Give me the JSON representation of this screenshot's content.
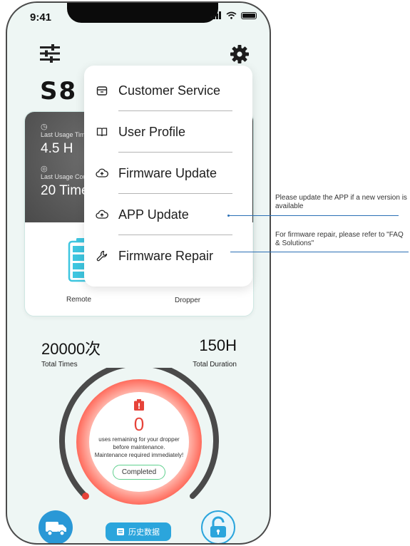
{
  "status_bar": {
    "time": "9:41"
  },
  "header": {
    "model": "S8"
  },
  "usage": [
    {
      "label": "Last Usage Time",
      "value": "4.5 H",
      "icon": "clock-icon"
    },
    {
      "label": "Last Usage Count",
      "value": "20 Times",
      "icon": "counter-icon"
    }
  ],
  "devices": {
    "remote_label": "Remote",
    "dropper_label": "Dropper"
  },
  "stats": {
    "total_times_value": "20000次",
    "total_times_label": "Total Times",
    "total_duration_value": "150H",
    "total_duration_label": "Total Duration"
  },
  "gauge": {
    "count": "0",
    "line1": "uses remaining for your dropper",
    "line2": "before maintenance.",
    "line3": "Maintenance required immediately!",
    "button": "Completed",
    "level": 0,
    "accent": "#e6433a"
  },
  "bottom_bar": {
    "history_label": "历史数据"
  },
  "menu": {
    "items": [
      {
        "label": "Customer Service",
        "icon": "service-icon"
      },
      {
        "label": "User Profile",
        "icon": "book-icon"
      },
      {
        "label": "Firmware Update",
        "icon": "cloud-upload-icon"
      },
      {
        "label": "APP Update",
        "icon": "cloud-upload-icon"
      },
      {
        "label": "Firmware Repair",
        "icon": "wrench-icon"
      }
    ]
  },
  "annotations": {
    "app_update": "Please update the APP if a new version is available",
    "firmware_repair": "For firmware repair, please refer to \"FAQ & Solutions\""
  },
  "colors": {
    "brand": "#2ba5dc",
    "accent": "#e6433a",
    "success": "#5fd08e"
  }
}
